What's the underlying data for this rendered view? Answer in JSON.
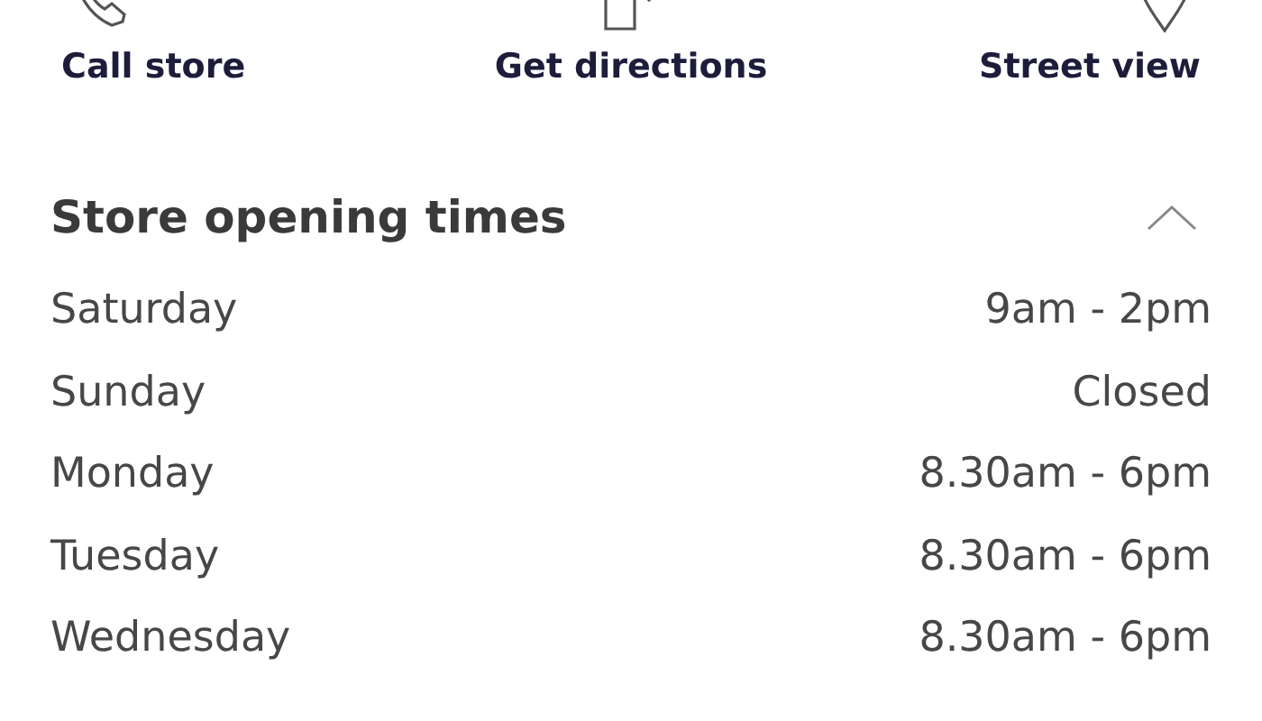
{
  "actions": [
    {
      "kind": "phone",
      "label": "Call store"
    },
    {
      "kind": "directions",
      "label": "Get directions"
    },
    {
      "kind": "pin",
      "label": "Street view"
    }
  ],
  "opening_times": {
    "title": "Store opening times",
    "expanded": true,
    "rows": [
      {
        "day": "Saturday",
        "hours": "9am - 2pm"
      },
      {
        "day": "Sunday",
        "hours": "Closed"
      },
      {
        "day": "Monday",
        "hours": "8.30am - 6pm"
      },
      {
        "day": "Tuesday",
        "hours": "8.30am - 6pm"
      },
      {
        "day": "Wednesday",
        "hours": "8.30am - 6pm"
      }
    ]
  }
}
